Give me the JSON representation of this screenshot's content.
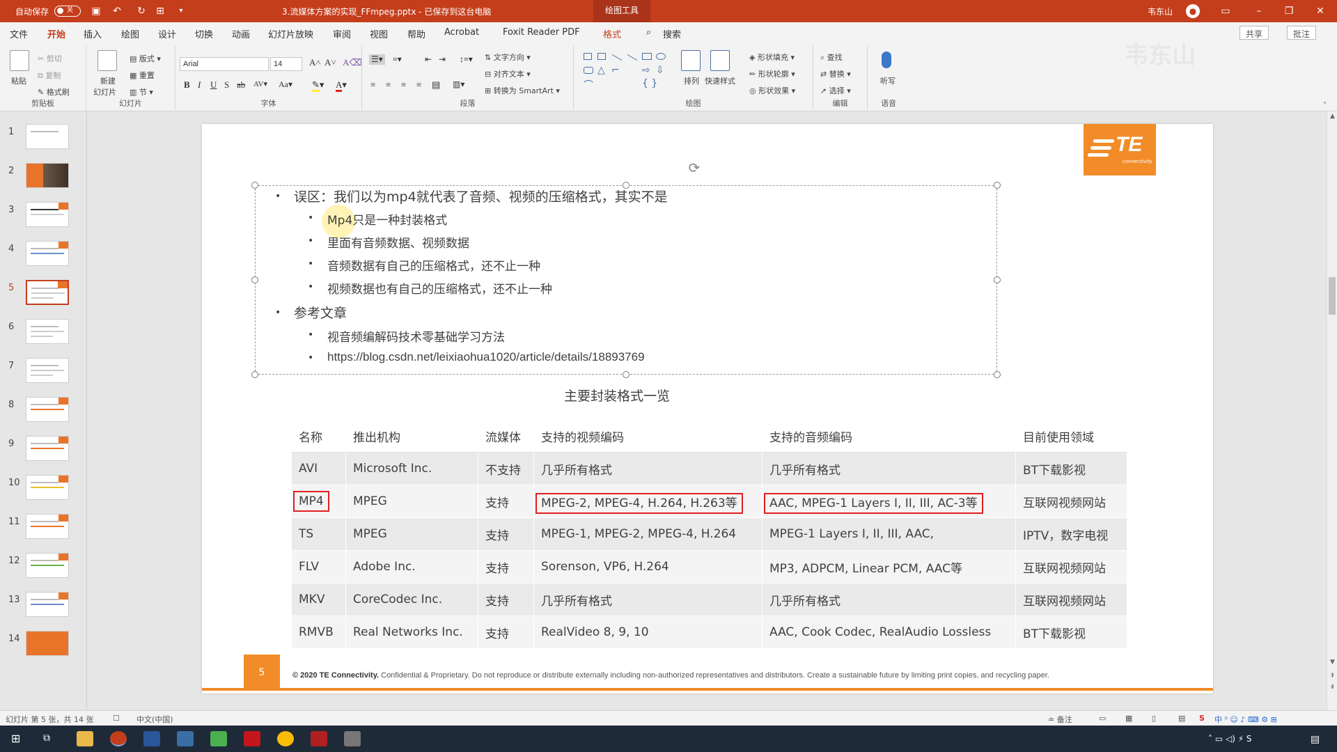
{
  "titlebar": {
    "autosave_label": "自动保存",
    "autosave_state": "关",
    "doc_title": "3.流媒体方案的实现_FFmpeg.pptx - 已保存到这台电脑",
    "context_tab": "绘图工具",
    "user_name": "韦东山"
  },
  "menu": {
    "items": [
      "文件",
      "开始",
      "插入",
      "绘图",
      "设计",
      "切换",
      "动画",
      "幻灯片放映",
      "审阅",
      "视图",
      "帮助",
      "Acrobat",
      "Foxit Reader PDF",
      "格式"
    ],
    "active": "开始",
    "search_label": "搜索",
    "share_label": "共享",
    "comment_label": "批注"
  },
  "ribbon": {
    "clipboard": {
      "paste": "粘贴",
      "cut": "剪切",
      "copy": "复制",
      "format_painter": "格式刷",
      "label": "剪贴板"
    },
    "slides": {
      "new_slide": "新建",
      "new_slide2": "幻灯片",
      "layout": "版式",
      "reset": "重置",
      "section": "节",
      "label": "幻灯片"
    },
    "font": {
      "name": "Arial",
      "size": "14",
      "label": "字体"
    },
    "paragraph": {
      "text_direction": "文字方向",
      "align_text": "对齐文本",
      "smartart": "转换为 SmartArt",
      "label": "段落"
    },
    "drawing": {
      "arrange": "排列",
      "quick_styles": "快速样式",
      "shape_fill": "形状填充",
      "shape_outline": "形状轮廓",
      "shape_effects": "形状效果",
      "label": "绘图"
    },
    "editing": {
      "find": "查找",
      "replace": "替换",
      "select": "选择",
      "label": "编辑"
    },
    "voice": {
      "dictate": "听写",
      "label": "语音"
    }
  },
  "watermark": "韦东山",
  "thumbnails": {
    "numbers": [
      "1",
      "2",
      "3",
      "4",
      "5",
      "6",
      "7",
      "8",
      "9",
      "10",
      "11",
      "12",
      "13",
      "14"
    ],
    "selected": "5"
  },
  "slide": {
    "logo_text": "TE",
    "logo_sub": "connectivity",
    "bullets": {
      "b1": "误区：我们以为mp4就代表了音频、视频的压缩格式，其实不是",
      "b1_subs": [
        "Mp4只是一种封装格式",
        "里面有音频数据、视频数据",
        "音频数据有自己的压缩格式，还不止一种",
        "视频数据也有自己的压缩格式，还不止一种"
      ],
      "b2": "参考文章",
      "b2_subs": [
        "视音频编解码技术零基础学习方法",
        "https://blog.csdn.net/leixiaohua1020/article/details/18893769"
      ]
    },
    "table_title": "主要封装格式一览",
    "table": {
      "headers": [
        "名称",
        "推出机构",
        "流媒体",
        "支持的视频编码",
        "支持的音频编码",
        "目前使用领域"
      ],
      "rows": [
        [
          "AVI",
          "Microsoft Inc.",
          "不支持",
          "几乎所有格式",
          "几乎所有格式",
          "BT下载影视"
        ],
        [
          "MP4",
          "MPEG",
          "支持",
          "MPEG-2, MPEG-4, H.264, H.263等",
          "AAC, MPEG-1 Layers I, II, III, AC-3等",
          "互联网视频网站"
        ],
        [
          "TS",
          "MPEG",
          "支持",
          "MPEG-1, MPEG-2, MPEG-4, H.264",
          "MPEG-1 Layers I, II, III, AAC,",
          "IPTV，数字电视"
        ],
        [
          "FLV",
          "Adobe Inc.",
          "支持",
          "Sorenson, VP6, H.264",
          "MP3, ADPCM, Linear PCM, AAC等",
          "互联网视频网站"
        ],
        [
          "MKV",
          "CoreCodec Inc.",
          "支持",
          "几乎所有格式",
          "几乎所有格式",
          "互联网视频网站"
        ],
        [
          "RMVB",
          "Real Networks Inc.",
          "支持",
          "RealVideo 8, 9, 10",
          "AAC, Cook Codec, RealAudio Lossless",
          "BT下载影视"
        ]
      ]
    },
    "page_number": "5",
    "copyright_bold": "© 2020 TE Connectivity.",
    "copyright_rest": " Confidential & Proprietary. Do not reproduce or distribute externally including non-authorized representatives and distributors. Create a sustainable future by limiting print copies, and recycling paper."
  },
  "status": {
    "slide_info": "幻灯片 第 5 张，共 14 张",
    "language": "中文(中国)",
    "notes": "备注"
  },
  "colors": {
    "accent": "#c43e1c",
    "brand_orange": "#f28c28",
    "highlight_red": "#e02020"
  }
}
